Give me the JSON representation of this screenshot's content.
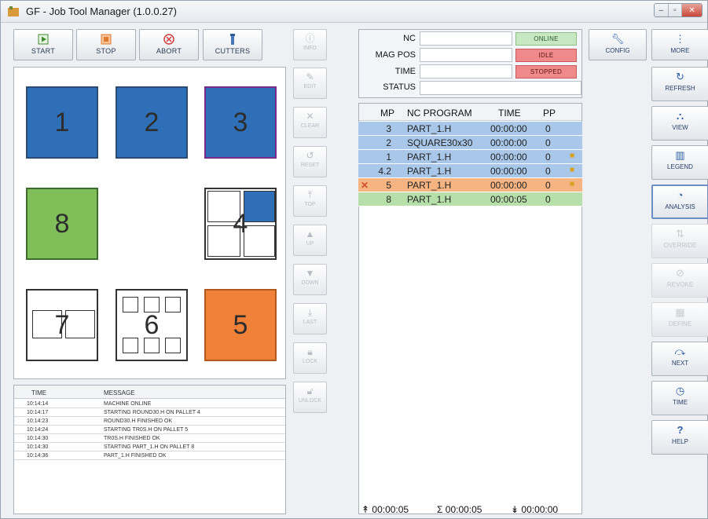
{
  "window": {
    "title": "GF - Job Tool Manager (1.0.0.27)"
  },
  "toolbar": {
    "start": "START",
    "stop": "STOP",
    "abort": "ABORT",
    "cutters": "CUTTERS"
  },
  "magazine": {
    "slots": [
      {
        "num": "1",
        "color": "blue"
      },
      {
        "num": "2",
        "color": "blue"
      },
      {
        "num": "3",
        "color": "blue3"
      },
      {
        "num": "8",
        "color": "green"
      },
      {
        "num": "4",
        "color": "white"
      },
      {
        "num": "7",
        "color": "white"
      },
      {
        "num": "6",
        "color": "white"
      },
      {
        "num": "5",
        "color": "orange"
      }
    ]
  },
  "log": {
    "headers": {
      "time": "TIME",
      "message": "MESSAGE"
    },
    "rows": [
      {
        "time": "10:14:14",
        "message": "MACHINE ONLINE"
      },
      {
        "time": "10:14:17",
        "message": "STARTING ROUND30.H ON PALLET 4"
      },
      {
        "time": "10:14:23",
        "message": "ROUND30.H FINISHED OK"
      },
      {
        "time": "10:14:24",
        "message": "STARTING TR0S.H ON PALLET 5"
      },
      {
        "time": "10:14:30",
        "message": "TR0S.H FINISHED OK"
      },
      {
        "time": "10:14:30",
        "message": "STARTING PART_1.H ON PALLET 8"
      },
      {
        "time": "10:14:36",
        "message": "PART_1.H FINISHED OK"
      }
    ]
  },
  "job_buttons": {
    "info": "INFO",
    "edit": "EDIT",
    "clear": "CLEAR",
    "reset": "RESET",
    "top": "TOP",
    "up": "UP",
    "down": "DOWN",
    "last": "LAST",
    "lock": "LOCK",
    "unlock": "UNLOCK"
  },
  "status_panel": {
    "nc_label": "NC",
    "mag_pos_label": "MAG POS",
    "time_label": "TIME",
    "status_label": "STATUS",
    "nc_status": "ONLINE",
    "mag_status": "IDLE",
    "time_status": "STOPPED",
    "colors": {
      "online": "#c7e8c2",
      "idle": "#f08a8a",
      "stopped": "#f08a8a"
    }
  },
  "grid": {
    "headers": {
      "mp": "MP",
      "program": "NC PROGRAM",
      "time": "TIME",
      "pp": "PP"
    },
    "rows": [
      {
        "mp": "3",
        "program": "PART_1.H",
        "time": "00:00:00",
        "pp": "0",
        "color": "#a9c7e8",
        "marker": "",
        "side": ""
      },
      {
        "mp": "2",
        "program": "SQUARE30x30",
        "time": "00:00:00",
        "pp": "0",
        "color": "#a9c7e8",
        "marker": "",
        "side": ""
      },
      {
        "mp": "1",
        "program": "PART_1.H",
        "time": "00:00:00",
        "pp": "0",
        "color": "#a9c7e8",
        "marker": "",
        "side": "lock"
      },
      {
        "mp": "4.2",
        "program": "PART_1.H",
        "time": "00:00:00",
        "pp": "0",
        "color": "#a9c7e8",
        "marker": "",
        "side": "lock"
      },
      {
        "mp": "5",
        "program": "PART_1.H",
        "time": "00:00:00",
        "pp": "0",
        "color": "#f6b483",
        "marker": "x",
        "side": "lock"
      },
      {
        "mp": "8",
        "program": "PART_1.H",
        "time": "00:00:05",
        "pp": "0",
        "color": "#b7dfa9",
        "marker": "",
        "side": ""
      }
    ]
  },
  "footer": {
    "up_time": "00:00:05",
    "sum_time": "00:00:05",
    "down_time": "00:00:00"
  },
  "right_buttons": {
    "config": "CONFIG",
    "more": "MORE",
    "refresh": "REFRESH",
    "view": "VIEW",
    "legend": "LEGEND",
    "analysis": "ANALYSIS",
    "override": "OVERRIDE",
    "revoke": "REVOKE",
    "define": "DEFINE",
    "next": "NEXT",
    "time": "TIME",
    "help": "HELP"
  }
}
